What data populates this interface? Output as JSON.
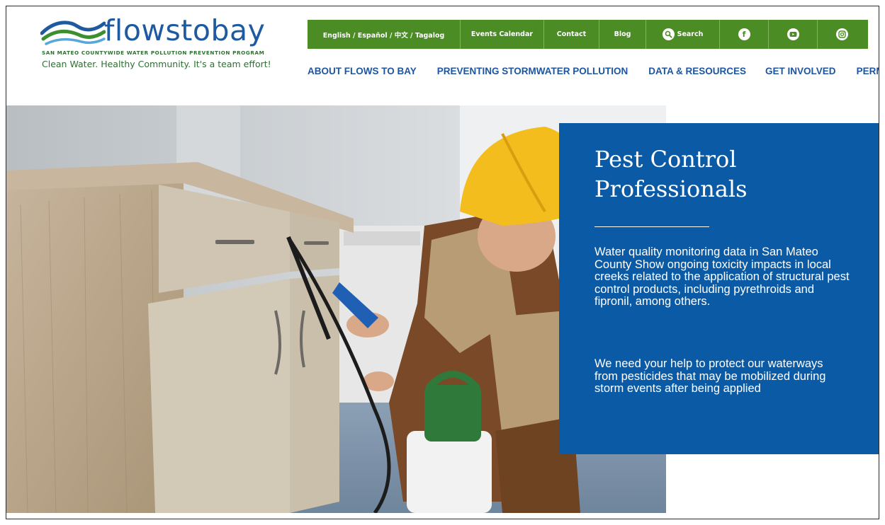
{
  "logo": {
    "wordmark": "flowstobay",
    "program": "SAN MATEO COUNTYWIDE WATER POLLUTION PREVENTION PROGRAM",
    "tagline": "Clean Water. Healthy Community. It's a team effort!"
  },
  "topbar": {
    "languages": "English  /  Español  /  中文  /  Tagalog",
    "events": "Events Calendar",
    "contact": "Contact",
    "blog": "Blog",
    "search": "Search",
    "icons": [
      "facebook-icon",
      "youtube-icon",
      "instagram-icon"
    ],
    "color": "#4c8c25"
  },
  "nav": [
    "ABOUT FLOWS TO BAY",
    "PREVENTING STORMWATER POLLUTION",
    "DATA & RESOURCES",
    "GET INVOLVED",
    "PERMITTEES"
  ],
  "hero": {
    "title": "Pest Control Professionals",
    "paragraph1": "Water quality monitoring data in San Mateo County Show ongoing toxicity impacts in local creeks related to the application of structural pest control products, including pyrethroids and fipronil, among others.",
    "paragraph2": "We need your help to protect our waterways from pesticides that may be mobilized during storm events after being applied",
    "panel_color": "#0a5aa6"
  }
}
